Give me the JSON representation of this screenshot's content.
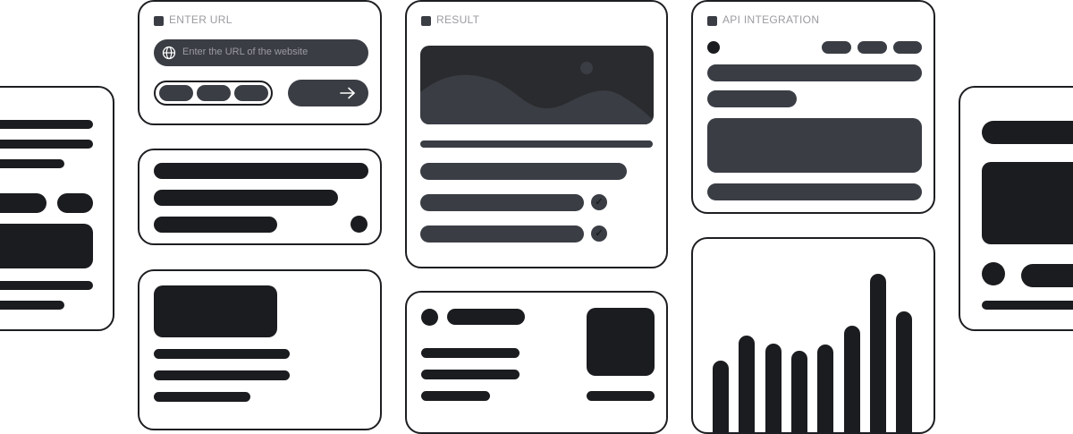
{
  "enter_url": {
    "label": "ENTER URL",
    "placeholder": "Enter the URL of the website",
    "globe_icon": "globe-icon",
    "arrow_icon": "arrow-right-icon"
  },
  "result": {
    "label": "RESULT",
    "image_icon": "landscape-image-icon",
    "check_icon": "check-icon"
  },
  "api": {
    "label": "API INTEGRATION"
  },
  "chart_data": {
    "type": "bar",
    "title": "",
    "categories": [
      "",
      "",
      "",
      "",
      "",
      "",
      "",
      ""
    ],
    "values": [
      80,
      108,
      99,
      91,
      98,
      119,
      177,
      135
    ]
  },
  "colors": {
    "dark": "#1b1c1f",
    "slate": "#3a3d44",
    "muted": "#9a9ba0",
    "border": "#1d1e21"
  }
}
